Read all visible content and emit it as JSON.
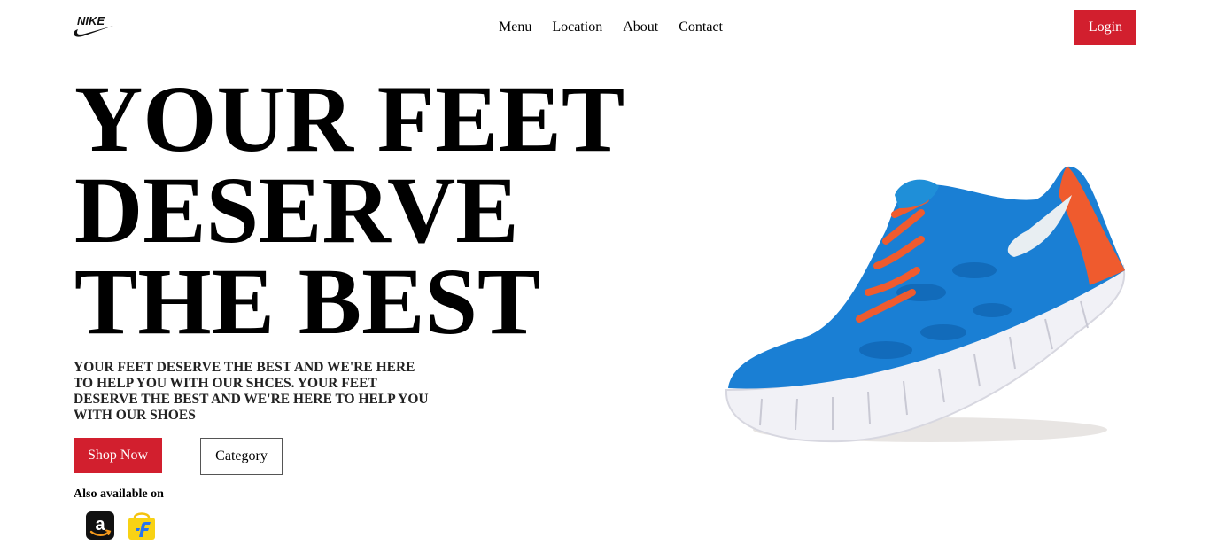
{
  "brand": {
    "logo_text": "NIKE",
    "accent": "#d21f2e"
  },
  "nav": {
    "items": [
      "Menu",
      "Location",
      "About",
      "Contact"
    ]
  },
  "header": {
    "login_label": "Login"
  },
  "hero": {
    "title_lines": [
      "YOUR FEET",
      "DESERVE",
      "THE BEST"
    ],
    "description": "YOUR FEET DESERVE THE BEST AND WE'RE HERE TO HELP YOU WITH OUR SHCES. YOUR FEET DESERVE THE BEST AND WE'RE HERE TO HELP YOU WITH OUR SHOES",
    "shop_label": "Shop Now",
    "category_label": "Category",
    "available_label": "Also available on",
    "stores": [
      "amazon-icon",
      "flipkart-icon"
    ]
  },
  "image": {
    "subject": "shoe-image"
  }
}
